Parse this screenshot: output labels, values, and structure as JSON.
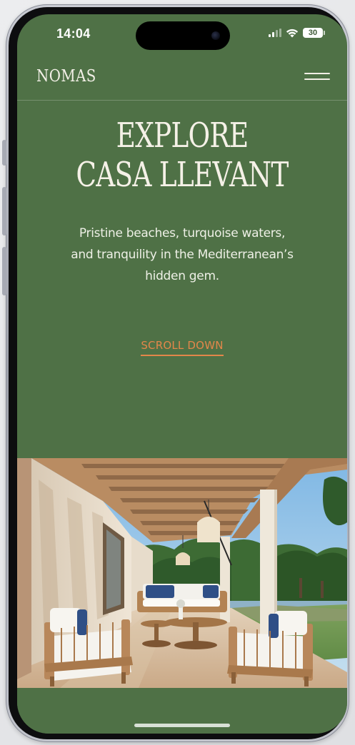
{
  "status_bar": {
    "time": "14:04",
    "battery_level": "30",
    "signal_bars_active": 2,
    "icons": [
      "cellular-signal-icon",
      "wifi-icon",
      "battery-icon"
    ]
  },
  "header": {
    "logo": "NOMAS",
    "menu_icon": "hamburger-menu-icon"
  },
  "hero": {
    "title_line1": "EXPLORE",
    "title_line2": "CASA LLEVANT",
    "subtitle": "Pristine beaches, turquoise waters, and tranquility in the Mediterranean’s hidden gem.",
    "scroll_label": "SCROLL DOWN"
  },
  "colors": {
    "page_green": "#4f7146",
    "text_cream": "#f5f1e7",
    "accent_orange": "#e3874a"
  }
}
